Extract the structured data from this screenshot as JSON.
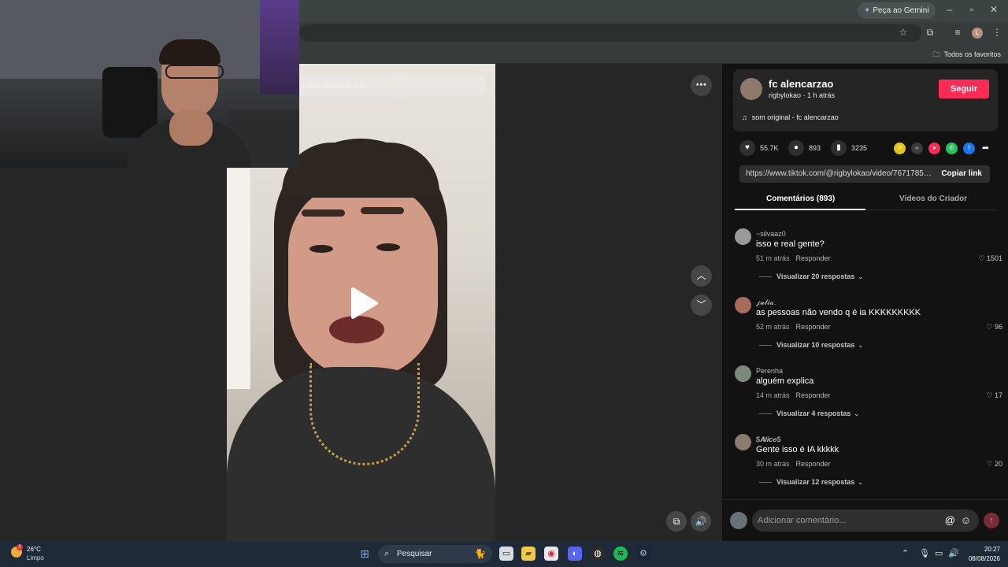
{
  "browser": {
    "gemini_label": "Peça ao Gemini",
    "profile_initial": "L",
    "bookmarks_all": "Todos os favoritos"
  },
  "video": {
    "related_search_placeholder": "teúdo relacionado"
  },
  "author": {
    "name": "fc alencarzao",
    "handle_time": "rigbylokao · 1 h atrás",
    "follow_label": "Seguir",
    "music": "som original - fc alencarzao"
  },
  "stats": {
    "likes": "55.7K",
    "comments": "893",
    "saves": "3235"
  },
  "link": {
    "url": "https://www.tiktok.com/@rigbylokao/video/76717856...",
    "copy_label": "Copiar link"
  },
  "tabs": [
    {
      "label": "Comentários (893)"
    },
    {
      "label": "Vídeos do Criador"
    }
  ],
  "comments": [
    {
      "user": "~silvaaz0",
      "text": "isso e real gente?",
      "time": "51 m atrás",
      "reply": "Responder",
      "likes": "1501",
      "replies": "Visualizar 20 respostas"
    },
    {
      "user": "𝓳𝓾𝓵𝓲𝓪.",
      "text": "as pessoas não vendo q é ia KKKKKKKKK",
      "time": "52 m atrás",
      "reply": "Responder",
      "likes": "96",
      "replies": "Visualizar 10 respostas"
    },
    {
      "user": "Perenha",
      "text": "alguém explica",
      "time": "14 m atrás",
      "reply": "Responder",
      "likes": "17",
      "replies": "Visualizar 4 respostas"
    },
    {
      "user": "$𝑨𝒍𝒊𝒄𝒆$",
      "text": "Gente isso é IA kkkkk",
      "time": "30 m atrás",
      "reply": "Responder",
      "likes": "20",
      "replies": "Visualizar 12 respostas"
    }
  ],
  "comment_input": {
    "placeholder": "Adicionar comentário..."
  },
  "taskbar": {
    "temperature": "26°C",
    "condition": "Limpo",
    "weather_badge": "1",
    "search_label": "Pesquisar",
    "time": "20:27",
    "date": "08/08/2026"
  }
}
